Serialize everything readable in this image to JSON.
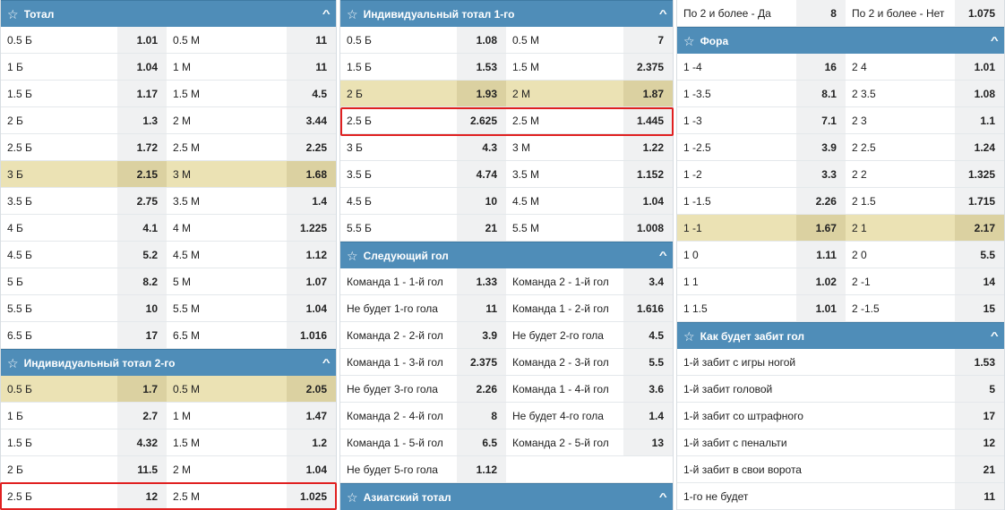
{
  "col1": {
    "total": {
      "title": "Тотал",
      "rows": [
        [
          "0.5 Б",
          "1.01",
          "0.5 М",
          "11"
        ],
        [
          "1 Б",
          "1.04",
          "1 М",
          "11"
        ],
        [
          "1.5 Б",
          "1.17",
          "1.5 М",
          "4.5"
        ],
        [
          "2 Б",
          "1.3",
          "2 М",
          "3.44"
        ],
        [
          "2.5 Б",
          "1.72",
          "2.5 М",
          "2.25"
        ],
        [
          "3 Б",
          "2.15",
          "3 М",
          "1.68"
        ],
        [
          "3.5 Б",
          "2.75",
          "3.5 М",
          "1.4"
        ],
        [
          "4 Б",
          "4.1",
          "4 М",
          "1.225"
        ],
        [
          "4.5 Б",
          "5.2",
          "4.5 М",
          "1.12"
        ],
        [
          "5 Б",
          "8.2",
          "5 М",
          "1.07"
        ],
        [
          "5.5 Б",
          "10",
          "5.5 М",
          "1.04"
        ],
        [
          "6.5 Б",
          "17",
          "6.5 М",
          "1.016"
        ]
      ]
    },
    "ind2": {
      "title": "Индивидуальный тотал 2-го",
      "rows": [
        [
          "0.5 Б",
          "1.7",
          "0.5 М",
          "2.05"
        ],
        [
          "1 Б",
          "2.7",
          "1 М",
          "1.47"
        ],
        [
          "1.5 Б",
          "4.32",
          "1.5 М",
          "1.2"
        ],
        [
          "2 Б",
          "11.5",
          "2 М",
          "1.04"
        ],
        [
          "2.5 Б",
          "12",
          "2.5 М",
          "1.025"
        ]
      ]
    }
  },
  "col2": {
    "ind1": {
      "title": "Индивидуальный тотал 1-го",
      "rows": [
        [
          "0.5 Б",
          "1.08",
          "0.5 М",
          "7"
        ],
        [
          "1.5 Б",
          "1.53",
          "1.5 М",
          "2.375"
        ],
        [
          "2 Б",
          "1.93",
          "2 М",
          "1.87"
        ],
        [
          "2.5 Б",
          "2.625",
          "2.5 М",
          "1.445"
        ],
        [
          "3 Б",
          "4.3",
          "3 М",
          "1.22"
        ],
        [
          "3.5 Б",
          "4.74",
          "3.5 М",
          "1.152"
        ],
        [
          "4.5 Б",
          "10",
          "4.5 М",
          "1.04"
        ],
        [
          "5.5 Б",
          "21",
          "5.5 М",
          "1.008"
        ]
      ]
    },
    "next": {
      "title": "Следующий гол",
      "rows": [
        [
          "Команда 1 - 1-й гол",
          "1.33",
          "Команда 2 - 1-й гол",
          "3.4"
        ],
        [
          "Не будет 1-го гола",
          "11",
          "Команда 1 - 2-й гол",
          "1.616"
        ],
        [
          "Команда 2 - 2-й гол",
          "3.9",
          "Не будет 2-го гола",
          "4.5"
        ],
        [
          "Команда 1 - 3-й гол",
          "2.375",
          "Команда 2 - 3-й гол",
          "5.5"
        ],
        [
          "Не будет 3-го гола",
          "2.26",
          "Команда 1 - 4-й гол",
          "3.6"
        ],
        [
          "Команда 2 - 4-й гол",
          "8",
          "Не будет 4-го гола",
          "1.4"
        ],
        [
          "Команда 1 - 5-й гол",
          "6.5",
          "Команда 2 - 5-й гол",
          "13"
        ],
        [
          "Не будет 5-го гола",
          "1.12",
          "",
          ""
        ]
      ]
    },
    "asian": {
      "title": "Азиатский тотал"
    }
  },
  "col3": {
    "top": {
      "rows": [
        [
          "По 2 и более - Да",
          "8",
          "По 2 и более - Нет",
          "1.075"
        ]
      ]
    },
    "fora": {
      "title": "Фора",
      "rows": [
        [
          "1 -4",
          "16",
          "2 4",
          "1.01"
        ],
        [
          "1 -3.5",
          "8.1",
          "2 3.5",
          "1.08"
        ],
        [
          "1 -3",
          "7.1",
          "2 3",
          "1.1"
        ],
        [
          "1 -2.5",
          "3.9",
          "2 2.5",
          "1.24"
        ],
        [
          "1 -2",
          "3.3",
          "2 2",
          "1.325"
        ],
        [
          "1 -1.5",
          "2.26",
          "2 1.5",
          "1.715"
        ],
        [
          "1 -1",
          "1.67",
          "2 1",
          "2.17"
        ],
        [
          "1 0",
          "1.11",
          "2 0",
          "5.5"
        ],
        [
          "1 1",
          "1.02",
          "2 -1",
          "14"
        ],
        [
          "1 1.5",
          "1.01",
          "2 -1.5",
          "15"
        ]
      ]
    },
    "how": {
      "title": "Как будет забит гол",
      "rows": [
        [
          "1-й забит с игры ногой",
          "1.53"
        ],
        [
          "1-й забит головой",
          "5"
        ],
        [
          "1-й забит со штрафного",
          "17"
        ],
        [
          "1-й забит с пенальти",
          "12"
        ],
        [
          "1-й забит в свои ворота",
          "21"
        ],
        [
          "1-го не будет",
          "11"
        ]
      ]
    }
  },
  "icons": {
    "star": "☆",
    "chevron": "^"
  },
  "highlight_color": "#ebe2b4",
  "header_color": "#4f8db8",
  "marker_color": "#e02020"
}
